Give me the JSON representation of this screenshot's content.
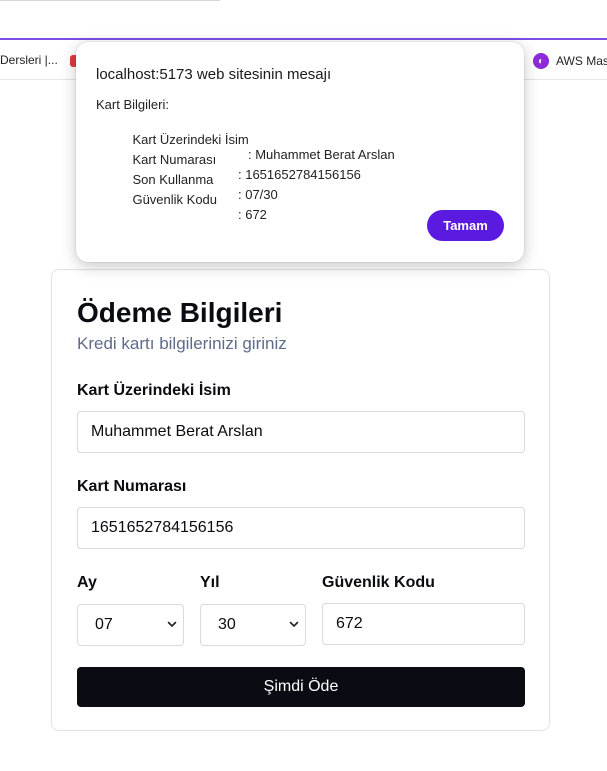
{
  "browser": {
    "bookmarks": {
      "left_item": "Dersleri |...",
      "right_item": "AWS Mas",
      "aws_icon": "aws-bookmark-icon"
    }
  },
  "alert": {
    "title": "localhost:5173 web sitesinin mesajı",
    "heading": "Kart Bilgileri:",
    "rows": [
      {
        "label": "Kart Üzerindeki İsim",
        "value": ": Muhammet Berat Arslan"
      },
      {
        "label": "Kart Numarası",
        "value": ": 1651652784156156"
      },
      {
        "label": "Son Kullanma",
        "value": ": 07/30"
      },
      {
        "label": "Güvenlik Kodu",
        "value": ": 672"
      }
    ],
    "ok_label": "Tamam"
  },
  "form": {
    "title": "Ödeme Bilgileri",
    "subtitle": "Kredi kartı bilgilerinizi giriniz",
    "name_label": "Kart Üzerindeki İsim",
    "name_value": "Muhammet Berat Arslan",
    "number_label": "Kart Numarası",
    "number_value": "1651652784156156",
    "month_label": "Ay",
    "month_value": "07",
    "year_label": "Yıl",
    "year_value": "30",
    "cvv_label": "Güvenlik Kodu",
    "cvv_value": "672",
    "pay_label": "Şimdi Öde"
  },
  "colors": {
    "accent": "#5b1ae0",
    "button_dark": "#0b0b14",
    "subtitle": "#5f6b8a"
  }
}
